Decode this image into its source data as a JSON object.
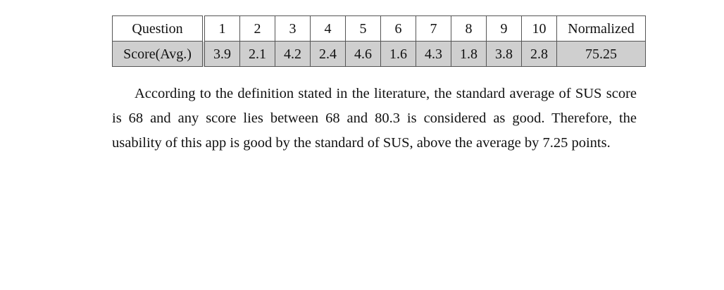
{
  "table": {
    "header": [
      "Question",
      "1",
      "2",
      "3",
      "4",
      "5",
      "6",
      "7",
      "8",
      "9",
      "10",
      "Normalized"
    ],
    "row": [
      "Score(Avg.)",
      "3.9",
      "2.1",
      "4.2",
      "2.4",
      "4.6",
      "1.6",
      "4.3",
      "1.8",
      "3.8",
      "2.8",
      "75.25"
    ]
  },
  "paragraph": "According to the definition stated in the literature, the standard average of SUS score is 68 and any score lies between 68 and 80.3 is considered as good. Therefore, the usability of this app is good by the standard of SUS, above the average by 7.25 points.",
  "colors": {
    "score_row_background": "#cfcfcf",
    "border": "#555555",
    "text": "#111111"
  }
}
